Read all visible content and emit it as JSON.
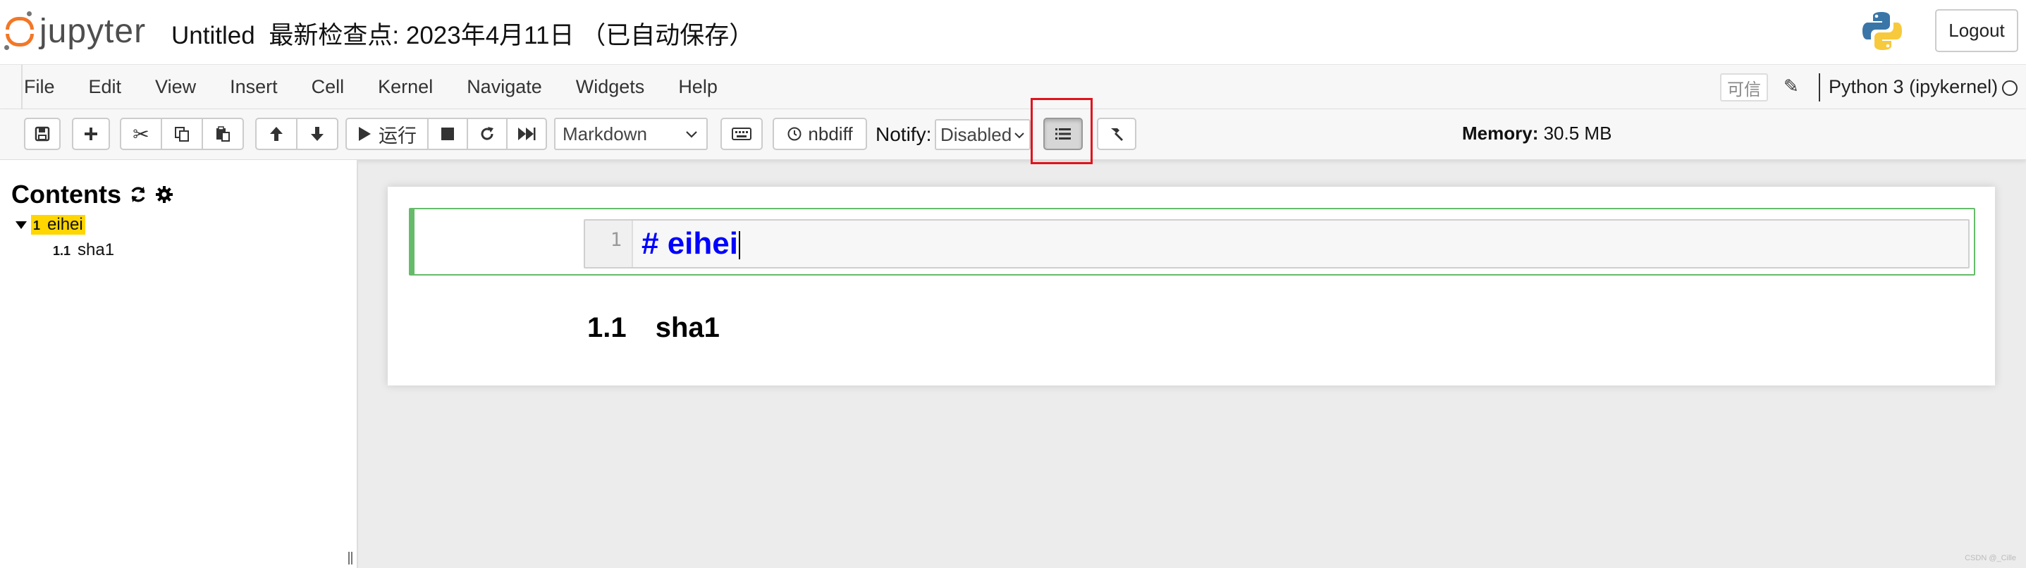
{
  "header": {
    "logo_text": "jupyter",
    "notebook_name": "Untitled",
    "checkpoint": "最新检查点: 2023年4月11日",
    "autosave": "（已自动保存）",
    "logout_label": "Logout"
  },
  "menubar": {
    "items": [
      "File",
      "Edit",
      "View",
      "Insert",
      "Cell",
      "Kernel",
      "Navigate",
      "Widgets",
      "Help"
    ],
    "trusted_label": "可信",
    "kernel_name": "Python 3 (ipykernel)"
  },
  "toolbar": {
    "run_label": "运行",
    "cell_type": "Markdown",
    "nbdiff_label": "nbdiff",
    "notify_label": "Notify:",
    "notify_value": "Disabled",
    "memory_label": "Memory:",
    "memory_value": "30.5 MB"
  },
  "toc": {
    "title": "Contents",
    "items": [
      {
        "num": "1",
        "label": "eihei"
      },
      {
        "num": "1.1",
        "label": "sha1"
      }
    ]
  },
  "notebook": {
    "cells": [
      {
        "line_number": "1",
        "source": "# eihei"
      },
      {
        "heading_num": "1.1",
        "heading_text": "sha1"
      }
    ]
  },
  "watermark": "CSDN @_Cille",
  "colors": {
    "jupyter_orange": "#f37726",
    "selected_cell": "#66bb6a",
    "toc_highlight": "#ffd600",
    "markdown_heading": "#0000ff",
    "annotation_red": "#e0141e"
  }
}
